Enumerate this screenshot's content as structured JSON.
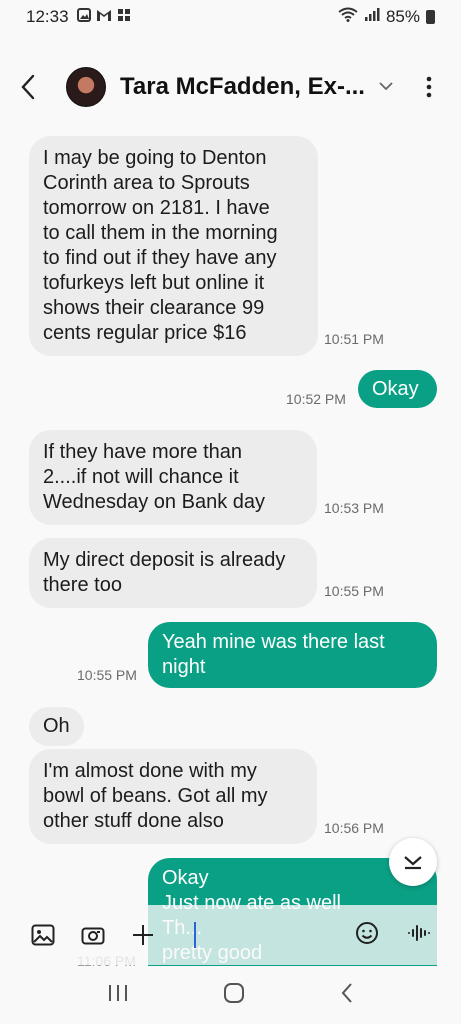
{
  "status": {
    "time": "12:33",
    "battery": "85%",
    "icons": [
      "gallery-icon",
      "gmail-icon",
      "app-icon",
      "wifi-icon",
      "signal-icon",
      "battery-icon"
    ]
  },
  "header": {
    "contact_name": "Tara McFadden, Ex-...",
    "icons": [
      "back-arrow-icon",
      "avatar",
      "chevron-down-icon",
      "more-vert-icon"
    ]
  },
  "messages": [
    {
      "dir": "in",
      "text": "I may be going to Denton\nCorinth area to Sprouts\ntomorrow on 2181. I have\nto call them in the morning\nto find out if they have any\ntofurkeys left but online it\nshows their clearance 99\ncents regular price $16",
      "time": "10:51 PM"
    },
    {
      "dir": "out",
      "text": "Okay",
      "time": "10:52 PM"
    },
    {
      "dir": "in",
      "text": "If they have more than\n2....if not will chance it\nWednesday on Bank day",
      "time": "10:53 PM"
    },
    {
      "dir": "in",
      "text": "My direct deposit is already\nthere too",
      "time": "10:55 PM"
    },
    {
      "dir": "out",
      "text": "Yeah mine was there last\nnight",
      "time": "10:55 PM"
    },
    {
      "dir": "in",
      "text": "Oh",
      "time": ""
    },
    {
      "dir": "in",
      "text": "I'm almost done with my\nbowl of beans. Got all my\nother stuff done also",
      "time": "10:56 PM"
    },
    {
      "dir": "out",
      "text": "Okay\nJust now ate as well\nTh...\npretty good",
      "time": "11:06 PM"
    }
  ],
  "composer": {
    "icons": [
      "gallery-icon",
      "camera-icon",
      "plus-icon",
      "emoji-icon",
      "voice-icon"
    ]
  },
  "colors": {
    "outgoing_bubble": "#0aa085",
    "incoming_bubble": "#ececec",
    "cursor": "#2c62d6"
  },
  "navbar": {
    "icons": [
      "recents-icon",
      "home-icon",
      "back-icon"
    ]
  }
}
